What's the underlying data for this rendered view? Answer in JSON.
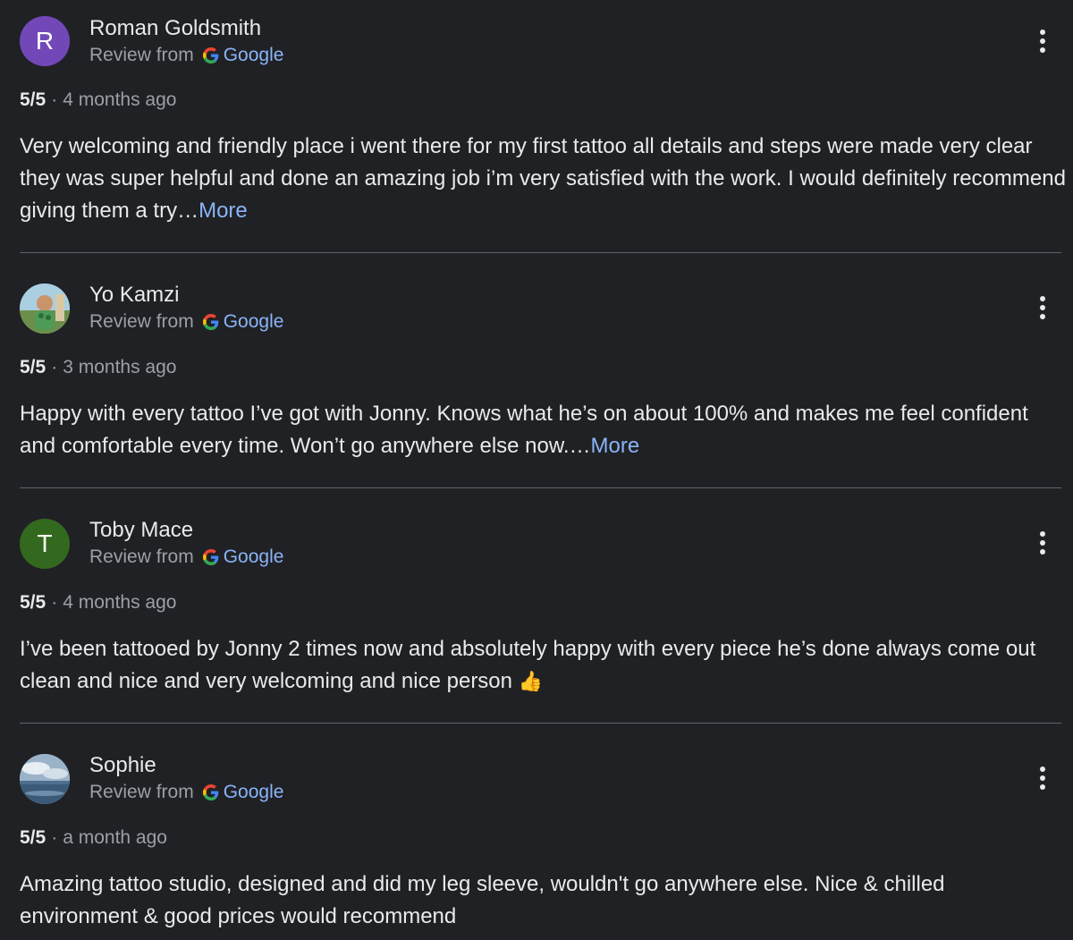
{
  "reviews": [
    {
      "avatar_letter": "R",
      "avatar_color": "#7248b9",
      "avatar_type": "letter",
      "name": "Roman Goldsmith",
      "source_prefix": "Review from",
      "source_name": "Google",
      "rating": "5/5",
      "separator": "·",
      "time": "4 months ago",
      "text": "Very welcoming and friendly place i went there for my first tattoo all details and steps were made very clear they was super helpful and done an amazing job i’m very satisfied with the work. I would definitely recommend giving them a try…",
      "more_label": "More"
    },
    {
      "avatar_type": "photo",
      "avatar_icon": "photo-avatar-icon",
      "name": "Yo Kamzi",
      "source_prefix": "Review from",
      "source_name": "Google",
      "rating": "5/5",
      "separator": "·",
      "time": "3 months ago",
      "text": "Happy with every tattoo I’ve got with Jonny. Knows what he’s on about 100% and makes me feel confident and comfortable every time. Won’t go anywhere else now.…",
      "more_label": "More"
    },
    {
      "avatar_letter": "T",
      "avatar_color": "#33691e",
      "avatar_type": "letter",
      "name": "Toby Mace",
      "source_prefix": "Review from",
      "source_name": "Google",
      "rating": "5/5",
      "separator": "·",
      "time": "4 months ago",
      "text": "I’ve been tattooed by Jonny 2 times now and absolutely happy with every piece he’s done always come out clean and nice and very welcoming and nice person ",
      "emoji": "👍"
    },
    {
      "avatar_type": "photo",
      "avatar_icon": "sky-photo-avatar-icon",
      "name": "Sophie",
      "source_prefix": "Review from",
      "source_name": "Google",
      "rating": "5/5",
      "separator": "·",
      "time": "a month ago",
      "text": "Amazing tattoo studio, designed and did my leg sleeve, wouldn't go anywhere else. Nice & chilled environment & good prices would recommend"
    }
  ],
  "icons": {
    "google": "google-g-icon",
    "menu": "more-vert-icon"
  }
}
